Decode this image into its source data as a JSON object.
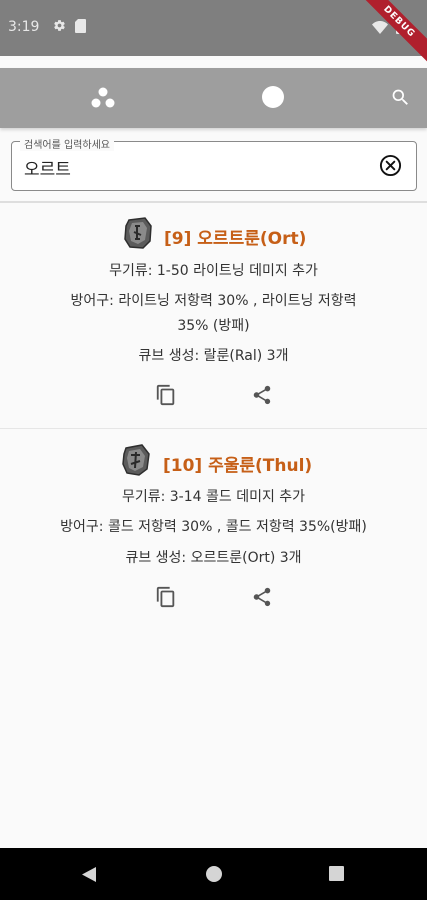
{
  "status_bar": {
    "time": "3:19",
    "icons": [
      "gear-icon",
      "sd-card-icon",
      "wifi-icon",
      "battery-icon"
    ]
  },
  "debug_banner": {
    "label": "DEBUG",
    "color": "#b0202d"
  },
  "app_bar": {
    "background": "#9e9e9e",
    "actions": [
      "dots-icon",
      "circle-icon",
      "search-icon"
    ]
  },
  "search": {
    "label": "검색어를 입력하세요",
    "value": "오르트"
  },
  "accent_color": "#c65f17",
  "results": [
    {
      "title": "[9] 오르트룬(Ort)",
      "weapon": "무기류: 1-50 라이트닝 데미지 추가",
      "armor_line1": "방어구: 라이트닝 저항력 30% , 라이트닝 저항력",
      "armor_line2": "35% (방패)",
      "cube": "큐브 생성: 랄룬(Ral) 3개",
      "actions": [
        "copy-icon",
        "share-icon"
      ]
    },
    {
      "title": "[10] 주울룬(Thul)",
      "weapon": "무기류: 3-14 콜드 데미지 추가",
      "armor_line1": "방어구: 콜드 저항력 30% , 콜드 저항력 35%(방패)",
      "cube": "큐브 생성: 오르트룬(Ort) 3개",
      "actions": [
        "copy-icon",
        "share-icon"
      ]
    }
  ],
  "nav_bar": [
    "back-icon",
    "home-icon",
    "recents-icon"
  ]
}
